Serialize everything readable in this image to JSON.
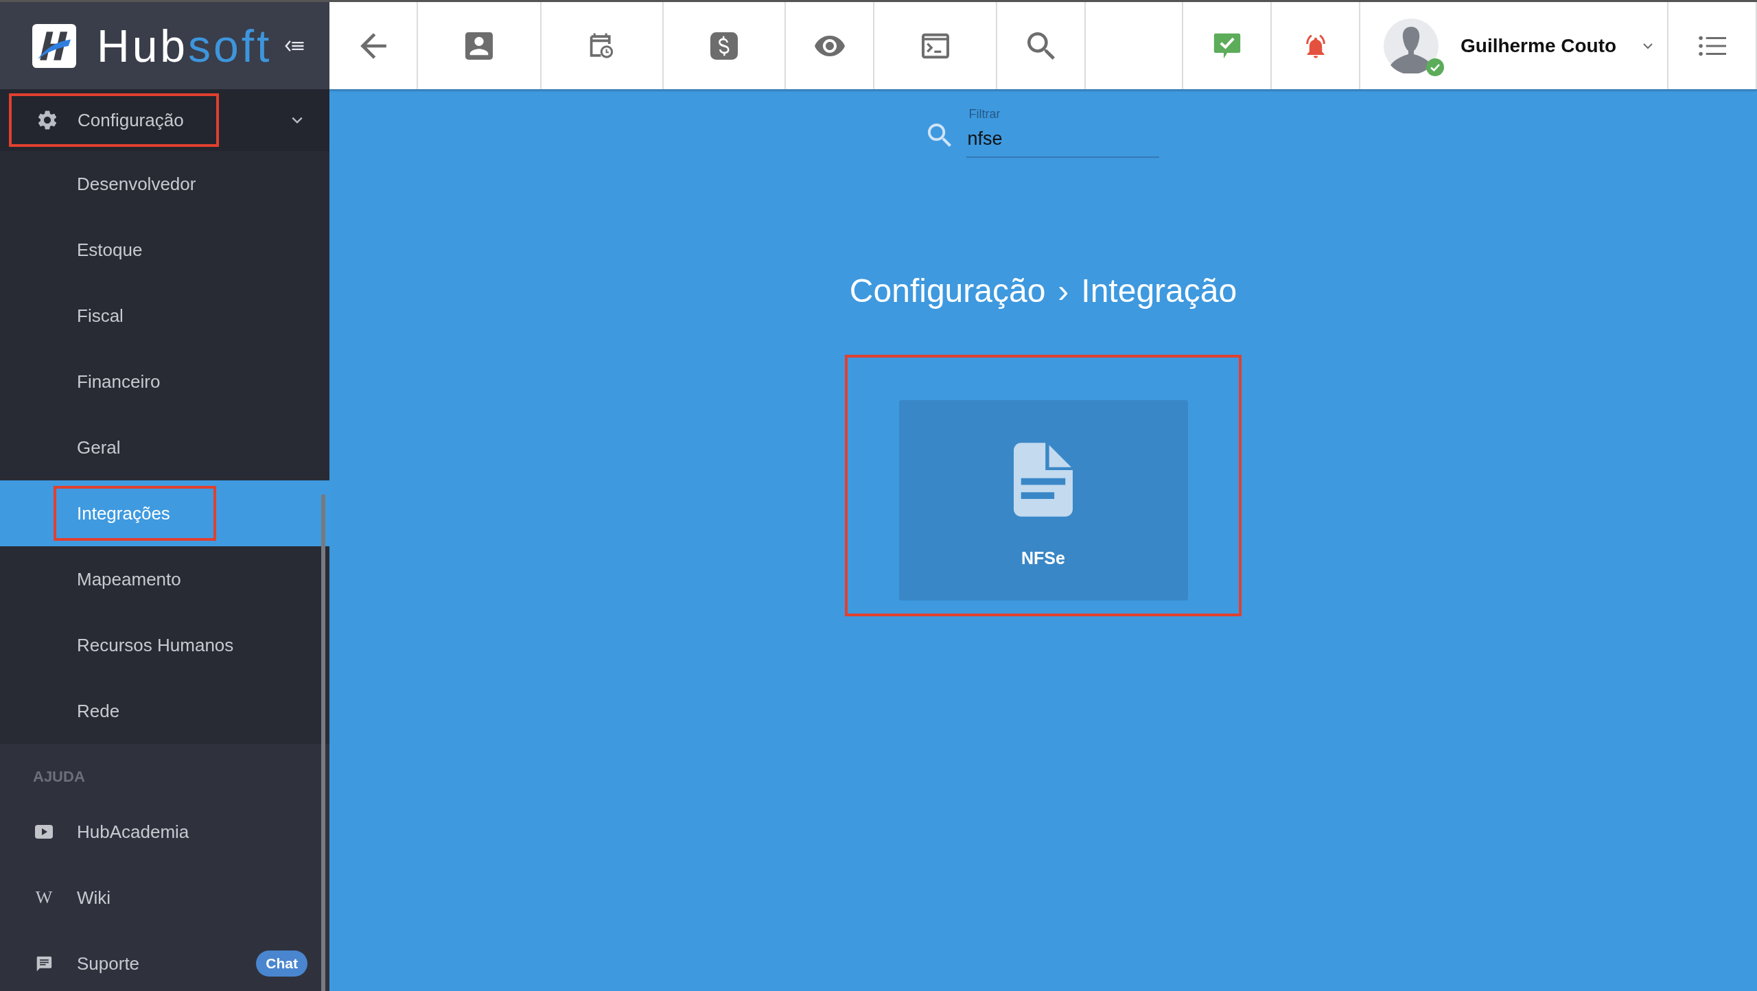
{
  "sidebar": {
    "brand": {
      "part1": "Hub",
      "part2": "soft"
    },
    "group": {
      "label": "Configuração",
      "expanded": true,
      "highlighted": true,
      "items": [
        {
          "label": "Desenvolvedor",
          "selected": false,
          "highlighted": false
        },
        {
          "label": "Estoque",
          "selected": false,
          "highlighted": false
        },
        {
          "label": "Fiscal",
          "selected": false,
          "highlighted": false
        },
        {
          "label": "Financeiro",
          "selected": false,
          "highlighted": false
        },
        {
          "label": "Geral",
          "selected": false,
          "highlighted": false
        },
        {
          "label": "Integrações",
          "selected": true,
          "highlighted": true
        },
        {
          "label": "Mapeamento",
          "selected": false,
          "highlighted": false
        },
        {
          "label": "Recursos Humanos",
          "selected": false,
          "highlighted": false
        },
        {
          "label": "Rede",
          "selected": false,
          "highlighted": false
        }
      ]
    },
    "help_heading": "AJUDA",
    "help_items": [
      {
        "kind": "video",
        "label": "HubAcademia"
      },
      {
        "kind": "wiki",
        "label": "Wiki",
        "icon_text": "W"
      },
      {
        "kind": "chat",
        "label": "Suporte",
        "badge": "Chat"
      }
    ]
  },
  "topbar": {
    "tools": [
      {
        "kind": "back"
      },
      {
        "kind": "contact"
      },
      {
        "kind": "calendar"
      },
      {
        "kind": "money"
      },
      {
        "kind": "eye"
      },
      {
        "kind": "terminal"
      },
      {
        "kind": "search"
      }
    ],
    "status": [
      {
        "kind": "tasks"
      },
      {
        "kind": "alerts"
      }
    ],
    "user": {
      "name": "Guilherme Couto",
      "online": true
    }
  },
  "filter": {
    "label": "Filtrar",
    "value": "nfse"
  },
  "breadcrumb": {
    "items": [
      "Configuração",
      "Integração"
    ],
    "separator": "›"
  },
  "cards": [
    {
      "label": "NFSe",
      "highlighted": true
    }
  ]
}
